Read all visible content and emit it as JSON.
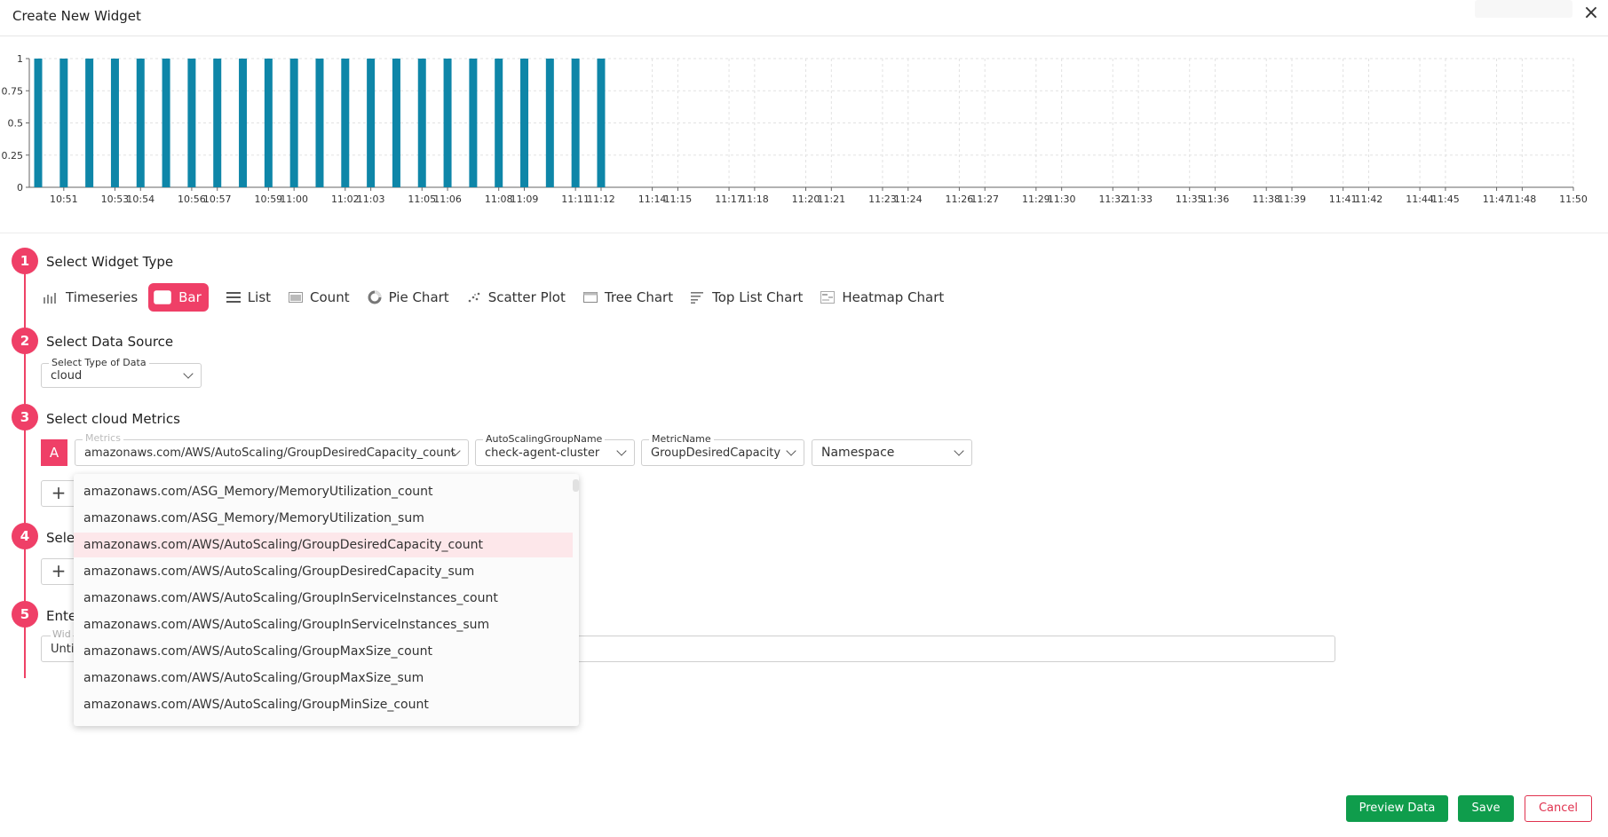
{
  "modal": {
    "title": "Create New Widget",
    "close_label": "×"
  },
  "chart_data": {
    "type": "bar",
    "yticks": [
      "0",
      "0.25",
      "0.5",
      "0.75",
      "1"
    ],
    "ylim": [
      0,
      1
    ],
    "x": [
      "10:50",
      "10:51",
      "10:52",
      "10:53",
      "10:54",
      "10:55",
      "10:56",
      "10:57",
      "10:58",
      "10:59",
      "11:00",
      "11:01",
      "11:02",
      "11:03",
      "11:04",
      "11:05",
      "11:06",
      "11:07",
      "11:08",
      "11:09",
      "11:10",
      "11:11",
      "11:12",
      "11:13",
      "11:14",
      "11:15",
      "11:16",
      "11:17",
      "11:18",
      "11:19",
      "11:20",
      "11:21",
      "11:22",
      "11:23",
      "11:24",
      "11:25",
      "11:26",
      "11:27",
      "11:28",
      "11:29",
      "11:30",
      "11:31",
      "11:32",
      "11:33",
      "11:34",
      "11:35",
      "11:36",
      "11:37",
      "11:38",
      "11:39",
      "11:40",
      "11:41",
      "11:42",
      "11:43",
      "11:44",
      "11:45",
      "11:46",
      "11:47",
      "11:48",
      "11:49",
      "11:50"
    ],
    "values": [
      1,
      1,
      1,
      1,
      1,
      1,
      1,
      1,
      1,
      1,
      1,
      1,
      1,
      1,
      1,
      1,
      1,
      1,
      1,
      1,
      1,
      1,
      1,
      null,
      null,
      null,
      null,
      null,
      null,
      null,
      null,
      null,
      null,
      null,
      null,
      null,
      null,
      null,
      null,
      null,
      null,
      null,
      null,
      null,
      null,
      null,
      null,
      null,
      null,
      null,
      null,
      null,
      null,
      null,
      null,
      null,
      null,
      null,
      null,
      null,
      null
    ],
    "xtick_labels": [
      "10:51",
      "10:53",
      "10:54",
      "10:56",
      "10:57",
      "10:59",
      "11:00",
      "11:02",
      "11:03",
      "11:05",
      "11:06",
      "11:08",
      "11:09",
      "11:11",
      "11:12",
      "11:14",
      "11:15",
      "11:17",
      "11:18",
      "11:20",
      "11:21",
      "11:23",
      "11:24",
      "11:26",
      "11:27",
      "11:29",
      "11:30",
      "11:32",
      "11:33",
      "11:35",
      "11:36",
      "11:38",
      "11:39",
      "11:41",
      "11:42",
      "11:44",
      "11:45",
      "11:47",
      "11:48",
      "11:50"
    ],
    "grid": true,
    "bar_color": "#0e86a8"
  },
  "steps": [
    {
      "number": "1",
      "title": "Select Widget Type"
    },
    {
      "number": "2",
      "title": "Select Data Source"
    },
    {
      "number": "3",
      "title": "Select cloud Metrics"
    },
    {
      "number": "4",
      "title": "Sele"
    },
    {
      "number": "5",
      "title": "Ente"
    }
  ],
  "widget_types": [
    {
      "label": "Timeseries",
      "icon": "timeseries-icon"
    },
    {
      "label": "Bar",
      "icon": "bar-chart-icon",
      "active": true
    },
    {
      "label": "List",
      "icon": "list-icon"
    },
    {
      "label": "Count",
      "icon": "count-icon"
    },
    {
      "label": "Pie Chart",
      "icon": "pie-chart-icon"
    },
    {
      "label": "Scatter Plot",
      "icon": "scatter-plot-icon"
    },
    {
      "label": "Tree Chart",
      "icon": "tree-chart-icon"
    },
    {
      "label": "Top List Chart",
      "icon": "top-list-icon"
    },
    {
      "label": "Heatmap Chart",
      "icon": "heatmap-icon"
    }
  ],
  "data_source": {
    "label": "Select Type of Data",
    "value": "cloud"
  },
  "query": {
    "letter": "A",
    "metrics": {
      "label": "Metrics",
      "value": "amazonaws.com/AWS/AutoScaling/GroupDesiredCapacity_count"
    },
    "asg": {
      "label": "AutoScalingGroupName",
      "value": "check-agent-cluster"
    },
    "metric_name": {
      "label": "MetricName",
      "value": "GroupDesiredCapacity"
    },
    "namespace": {
      "value": "Namespace"
    },
    "add_label": "+"
  },
  "step4_add_label": "+",
  "widget_name": {
    "label": "Wid",
    "value": "Unti"
  },
  "dropdown_options": [
    "amazonaws.com/ASG_Memory/MemoryUtilization_count",
    "amazonaws.com/ASG_Memory/MemoryUtilization_sum",
    "amazonaws.com/AWS/AutoScaling/GroupDesiredCapacity_count",
    "amazonaws.com/AWS/AutoScaling/GroupDesiredCapacity_sum",
    "amazonaws.com/AWS/AutoScaling/GroupInServiceInstances_count",
    "amazonaws.com/AWS/AutoScaling/GroupInServiceInstances_sum",
    "amazonaws.com/AWS/AutoScaling/GroupMaxSize_count",
    "amazonaws.com/AWS/AutoScaling/GroupMaxSize_sum",
    "amazonaws.com/AWS/AutoScaling/GroupMinSize_count"
  ],
  "dropdown_selected_index": 2,
  "footer": {
    "preview_label": "Preview Data",
    "save_label": "Save",
    "cancel_label": "Cancel"
  },
  "colors": {
    "accent": "#ef3f67",
    "green": "#0f9d4c",
    "bar": "#0e86a8"
  }
}
